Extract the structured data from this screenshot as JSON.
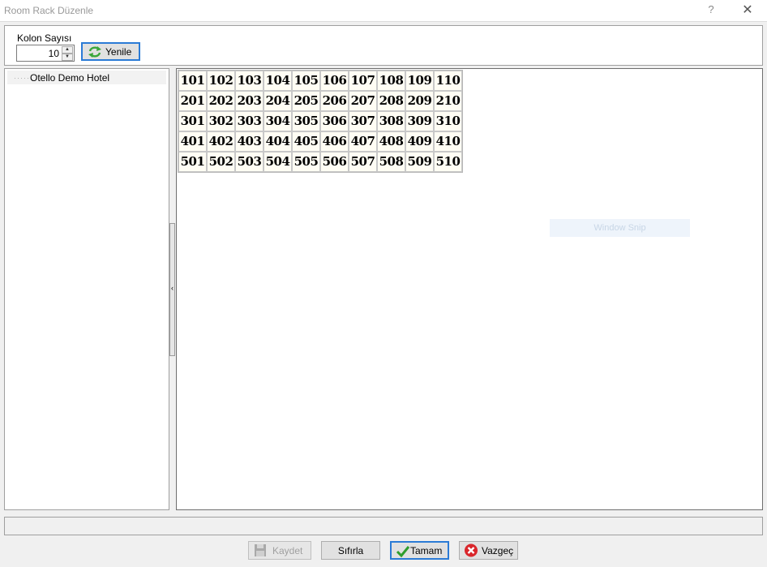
{
  "window": {
    "title": "Room Rack Düzenle",
    "help_glyph": "?",
    "close_glyph": "✕"
  },
  "params": {
    "kolon_label": "Kolon Sayısı",
    "kolon_value": "10",
    "spin_up_glyph": "▲",
    "spin_down_glyph": "▼",
    "yenile_label": "Yenile"
  },
  "tree": {
    "dots": "·····",
    "root_label": "Otello Demo Hotel"
  },
  "splitter": {
    "arrow_glyph": "‹"
  },
  "rack": {
    "rows": [
      [
        "101",
        "102",
        "103",
        "104",
        "105",
        "106",
        "107",
        "108",
        "109",
        "110"
      ],
      [
        "201",
        "202",
        "203",
        "204",
        "205",
        "206",
        "207",
        "208",
        "209",
        "210"
      ],
      [
        "301",
        "302",
        "303",
        "304",
        "305",
        "306",
        "307",
        "308",
        "309",
        "310"
      ],
      [
        "401",
        "402",
        "403",
        "404",
        "405",
        "406",
        "407",
        "408",
        "409",
        "410"
      ],
      [
        "501",
        "502",
        "503",
        "504",
        "505",
        "506",
        "507",
        "508",
        "509",
        "510"
      ]
    ],
    "overlay_text": "Window Snip"
  },
  "footer": {
    "kaydet_label": "Kaydet",
    "sifirla_label": "Sıfırla",
    "tamam_label": "Tamam",
    "vazgec_label": "Vazgeç"
  },
  "icons": {
    "refresh": "refresh-icon",
    "save": "save-disk-icon",
    "ok": "checkmark-icon",
    "cancel": "cancel-x-icon"
  },
  "colors": {
    "accent_border": "#2b7bd6",
    "room_cell_bg": "#fffdf4",
    "refresh_green": "#3aa63a",
    "ok_green": "#2e9e2e",
    "cancel_red": "#d9262b"
  }
}
